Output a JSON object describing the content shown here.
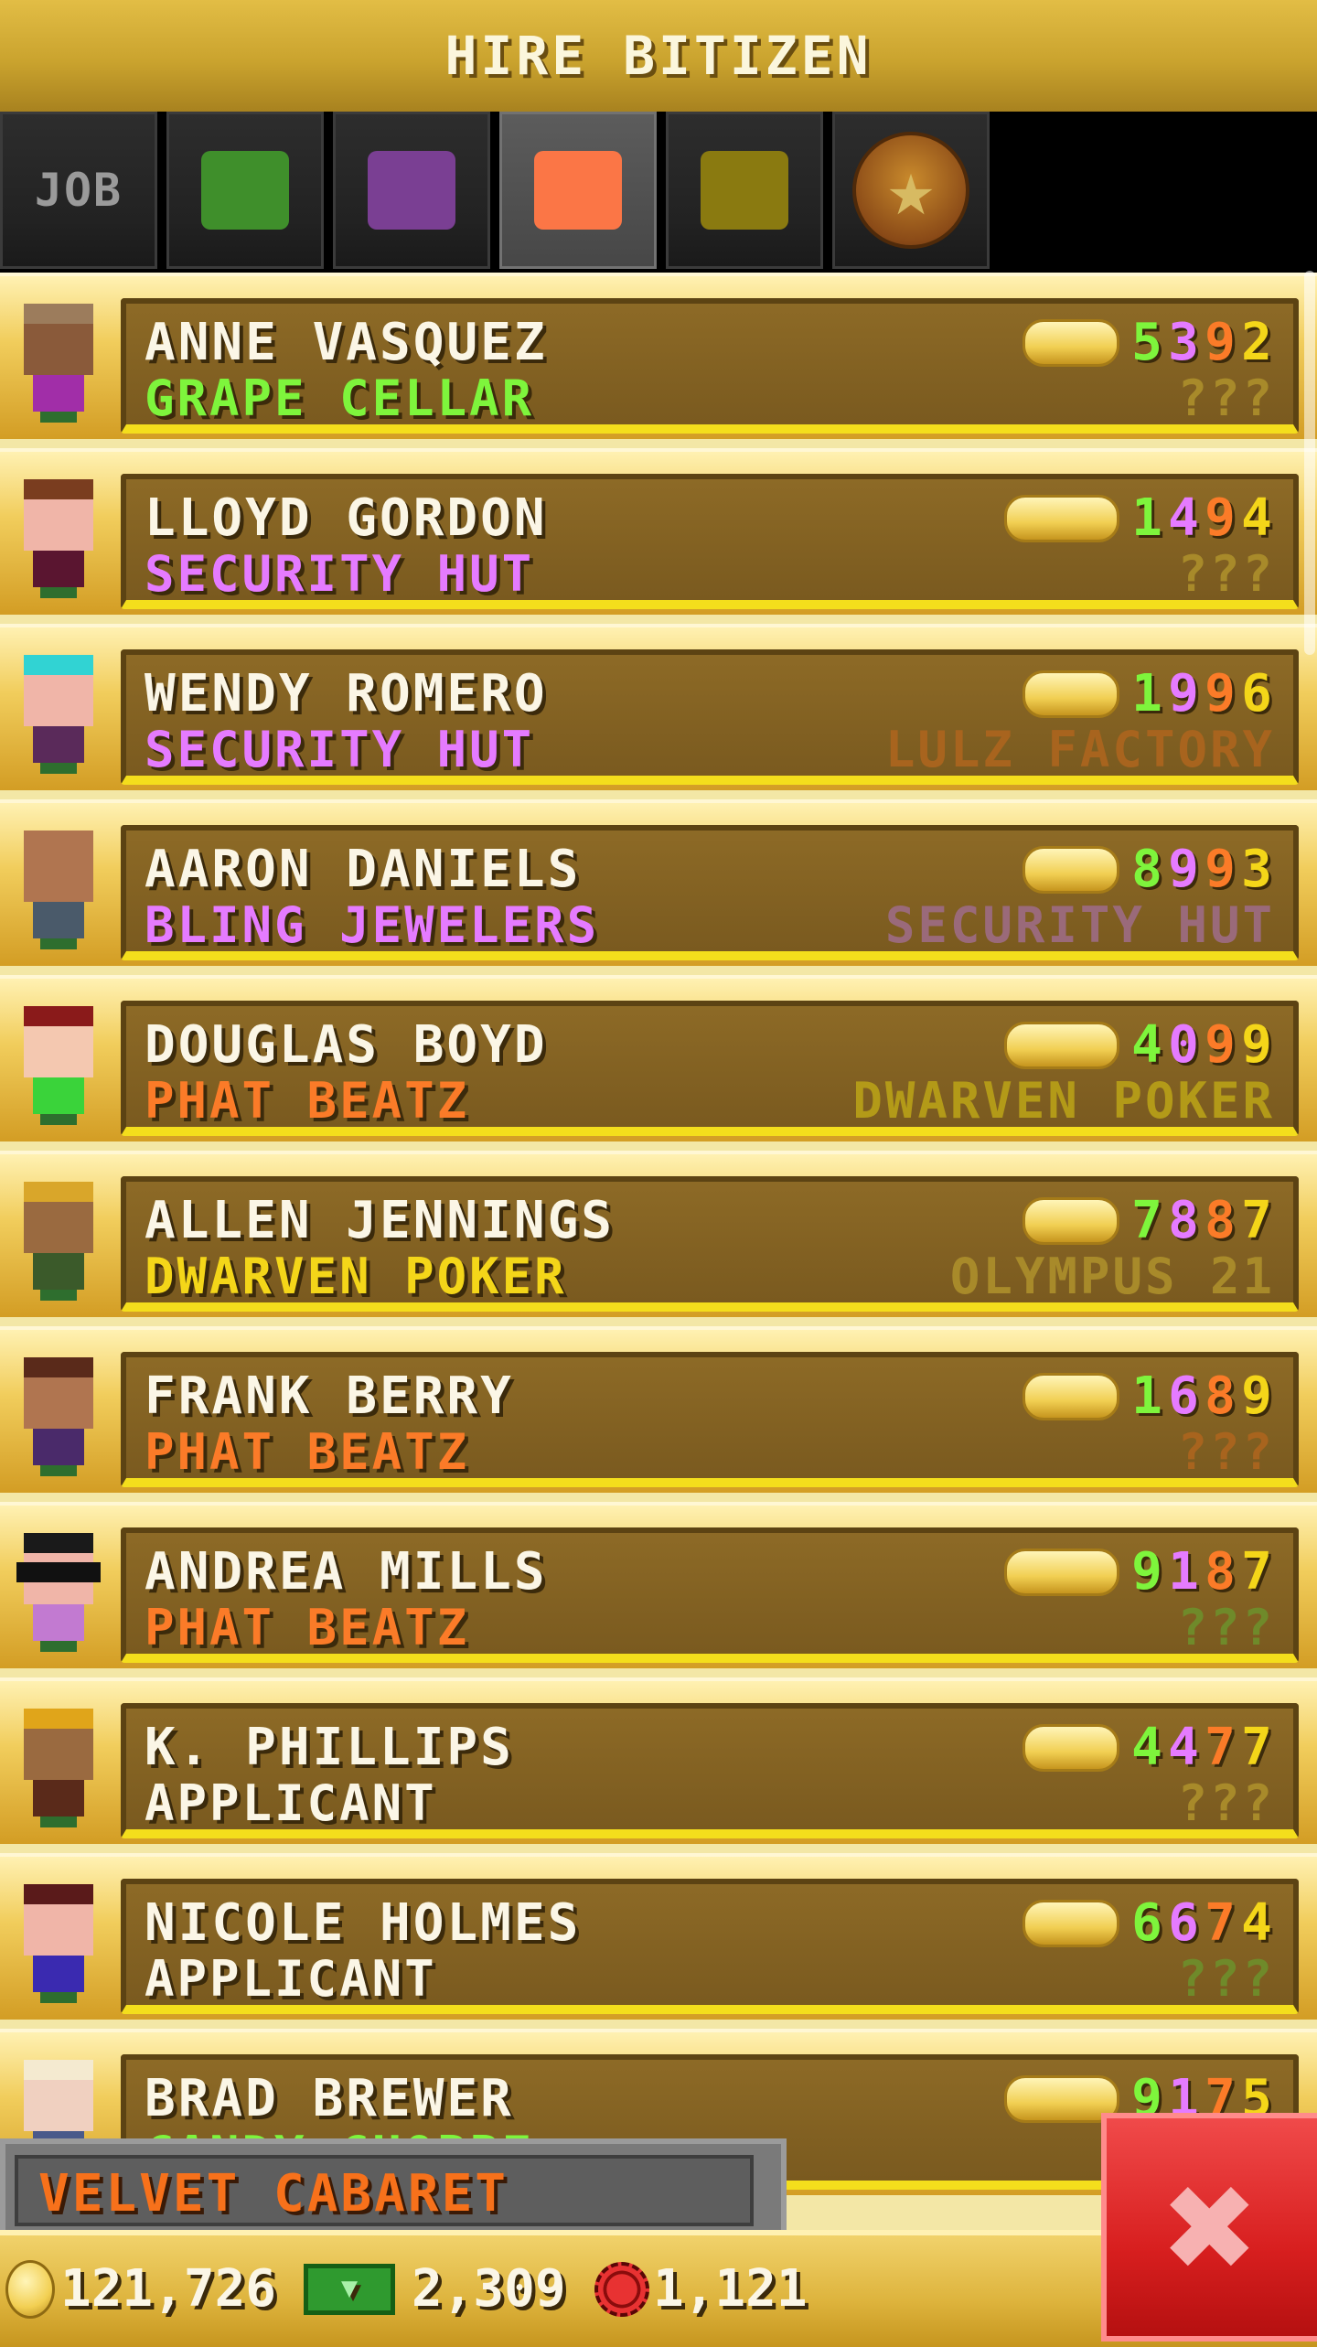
{
  "header": {
    "title": "HIRE BITIZEN"
  },
  "tabs": [
    {
      "id": "job",
      "label": "JOB",
      "color": ""
    },
    {
      "id": "green",
      "label": "",
      "color": "#3f8f2b"
    },
    {
      "id": "purple",
      "label": "",
      "color": "#7a3f93"
    },
    {
      "id": "orange",
      "label": "",
      "color": "#fb7646",
      "selected": true
    },
    {
      "id": "olive",
      "label": "",
      "color": "#8a7a10"
    },
    {
      "id": "star",
      "label": "",
      "icon": "star-badge-icon"
    }
  ],
  "bitizens": [
    {
      "name": "ANNE VASQUEZ",
      "job": "GRAPE CELLAR",
      "job_color": "#7ef53c",
      "dream": "???",
      "dream_color": "#a88a2a",
      "stats": [
        "5",
        "3",
        "9",
        "2"
      ],
      "skin": "#8a5a3a",
      "hair": "#9c7c5c",
      "shirt": "#a12ea8"
    },
    {
      "name": "LLOYD GORDON",
      "job": "SECURITY HUT",
      "job_color": "#e57bff",
      "dream": "???",
      "dream_color": "#a88a2a",
      "stats": [
        "1",
        "4",
        "9",
        "4"
      ],
      "skin": "#f0b5a8",
      "hair": "#7a3d1f",
      "shirt": "#5a1530"
    },
    {
      "name": "WENDY ROMERO",
      "job": "SECURITY HUT",
      "job_color": "#e57bff",
      "dream": "LULZ FACTORY",
      "dream_color": "#a8641e",
      "stats": [
        "1",
        "9",
        "9",
        "6"
      ],
      "skin": "#f0b5a8",
      "hair": "#31d3d3",
      "shirt": "#5a2a5a"
    },
    {
      "name": "AARON DANIELS",
      "job": "BLING JEWELERS",
      "job_color": "#e57bff",
      "dream": "SECURITY HUT",
      "dream_color": "#9a6a7a",
      "stats": [
        "8",
        "9",
        "9",
        "3"
      ],
      "skin": "#b07550",
      "hair": "#b07550",
      "shirt": "#4a5a6a"
    },
    {
      "name": "DOUGLAS BOYD",
      "job": "PHAT BEATZ",
      "job_color": "#fb7b28",
      "dream": "DWARVEN POKER",
      "dream_color": "#b39a18",
      "stats": [
        "4",
        "0",
        "9",
        "9"
      ],
      "skin": "#f4c8b0",
      "hair": "#8a1a1a",
      "shirt": "#3ad33a"
    },
    {
      "name": "ALLEN JENNINGS",
      "job": "DWARVEN POKER",
      "job_color": "#f4d619",
      "dream": "OLYMPUS 21",
      "dream_color": "#a88a2a",
      "stats": [
        "7",
        "8",
        "8",
        "7"
      ],
      "skin": "#9a6a40",
      "hair": "#d9a62a",
      "shirt": "#3b5a2a"
    },
    {
      "name": "FRANK BERRY",
      "job": "PHAT BEATZ",
      "job_color": "#fb7b28",
      "dream": "???",
      "dream_color": "#a8641e",
      "stats": [
        "1",
        "6",
        "8",
        "9"
      ],
      "skin": "#b07550",
      "hair": "#5a2a1a",
      "shirt": "#4a2a6a"
    },
    {
      "name": "ANDREA MILLS",
      "job": "PHAT BEATZ",
      "job_color": "#fb7b28",
      "dream": "???",
      "dream_color": "#6f8a2a",
      "stats": [
        "9",
        "1",
        "8",
        "7"
      ],
      "skin": "#f0b5a8",
      "hair": "#1a1a1a",
      "shirt": "#c27ad1",
      "glasses": true
    },
    {
      "name": "K. PHILLIPS",
      "job": "APPLICANT",
      "job_color": "#fbf6e6",
      "dream": "???",
      "dream_color": "#a88a2a",
      "stats": [
        "4",
        "4",
        "7",
        "7"
      ],
      "skin": "#9a6a40",
      "hair": "#e0a51a",
      "shirt": "#5a2a1a"
    },
    {
      "name": "NICOLE HOLMES",
      "job": "APPLICANT",
      "job_color": "#fbf6e6",
      "dream": "???",
      "dream_color": "#6f8a2a",
      "stats": [
        "6",
        "6",
        "7",
        "4"
      ],
      "skin": "#f0b5a8",
      "hair": "#5a1a1a",
      "shirt": "#3a2ab0"
    },
    {
      "name": "BRAD BREWER",
      "job": "CANDY CHOPPE",
      "job_color": "#7ef53c",
      "dream": "",
      "dream_color": "#a88a2a",
      "stats": [
        "9",
        "1",
        "7",
        "5"
      ],
      "skin": "#f0d0c0",
      "hair": "#f4ead0",
      "shirt": "#4a5a8a"
    }
  ],
  "stat_colors": [
    "#7ef53c",
    "#e57bff",
    "#fb7b28",
    "#f4d619"
  ],
  "tower": {
    "name": "VELVET CABARET"
  },
  "currency": {
    "coins": "121,726",
    "bux": "2,309",
    "chips": "1,121"
  },
  "colors": {
    "gold": "#d8ad34",
    "card": "#7f5f20",
    "accent_yellow": "#f4de1c",
    "close_red": "#e02a2a"
  }
}
